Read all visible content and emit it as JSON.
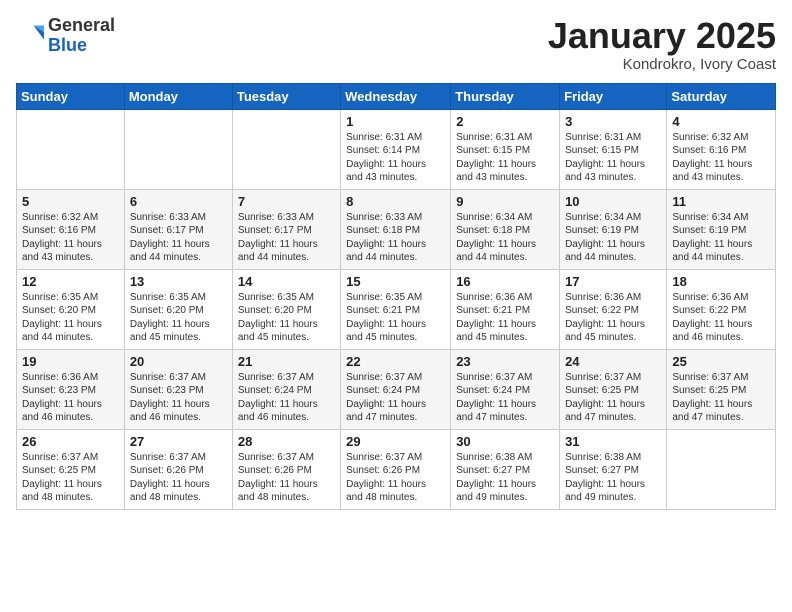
{
  "header": {
    "logo_general": "General",
    "logo_blue": "Blue",
    "month_title": "January 2025",
    "subtitle": "Kondrokro, Ivory Coast"
  },
  "weekdays": [
    "Sunday",
    "Monday",
    "Tuesday",
    "Wednesday",
    "Thursday",
    "Friday",
    "Saturday"
  ],
  "weeks": [
    [
      {
        "day": "",
        "info": ""
      },
      {
        "day": "",
        "info": ""
      },
      {
        "day": "",
        "info": ""
      },
      {
        "day": "1",
        "info": "Sunrise: 6:31 AM\nSunset: 6:14 PM\nDaylight: 11 hours\nand 43 minutes."
      },
      {
        "day": "2",
        "info": "Sunrise: 6:31 AM\nSunset: 6:15 PM\nDaylight: 11 hours\nand 43 minutes."
      },
      {
        "day": "3",
        "info": "Sunrise: 6:31 AM\nSunset: 6:15 PM\nDaylight: 11 hours\nand 43 minutes."
      },
      {
        "day": "4",
        "info": "Sunrise: 6:32 AM\nSunset: 6:16 PM\nDaylight: 11 hours\nand 43 minutes."
      }
    ],
    [
      {
        "day": "5",
        "info": "Sunrise: 6:32 AM\nSunset: 6:16 PM\nDaylight: 11 hours\nand 43 minutes."
      },
      {
        "day": "6",
        "info": "Sunrise: 6:33 AM\nSunset: 6:17 PM\nDaylight: 11 hours\nand 44 minutes."
      },
      {
        "day": "7",
        "info": "Sunrise: 6:33 AM\nSunset: 6:17 PM\nDaylight: 11 hours\nand 44 minutes."
      },
      {
        "day": "8",
        "info": "Sunrise: 6:33 AM\nSunset: 6:18 PM\nDaylight: 11 hours\nand 44 minutes."
      },
      {
        "day": "9",
        "info": "Sunrise: 6:34 AM\nSunset: 6:18 PM\nDaylight: 11 hours\nand 44 minutes."
      },
      {
        "day": "10",
        "info": "Sunrise: 6:34 AM\nSunset: 6:19 PM\nDaylight: 11 hours\nand 44 minutes."
      },
      {
        "day": "11",
        "info": "Sunrise: 6:34 AM\nSunset: 6:19 PM\nDaylight: 11 hours\nand 44 minutes."
      }
    ],
    [
      {
        "day": "12",
        "info": "Sunrise: 6:35 AM\nSunset: 6:20 PM\nDaylight: 11 hours\nand 44 minutes."
      },
      {
        "day": "13",
        "info": "Sunrise: 6:35 AM\nSunset: 6:20 PM\nDaylight: 11 hours\nand 45 minutes."
      },
      {
        "day": "14",
        "info": "Sunrise: 6:35 AM\nSunset: 6:20 PM\nDaylight: 11 hours\nand 45 minutes."
      },
      {
        "day": "15",
        "info": "Sunrise: 6:35 AM\nSunset: 6:21 PM\nDaylight: 11 hours\nand 45 minutes."
      },
      {
        "day": "16",
        "info": "Sunrise: 6:36 AM\nSunset: 6:21 PM\nDaylight: 11 hours\nand 45 minutes."
      },
      {
        "day": "17",
        "info": "Sunrise: 6:36 AM\nSunset: 6:22 PM\nDaylight: 11 hours\nand 45 minutes."
      },
      {
        "day": "18",
        "info": "Sunrise: 6:36 AM\nSunset: 6:22 PM\nDaylight: 11 hours\nand 46 minutes."
      }
    ],
    [
      {
        "day": "19",
        "info": "Sunrise: 6:36 AM\nSunset: 6:23 PM\nDaylight: 11 hours\nand 46 minutes."
      },
      {
        "day": "20",
        "info": "Sunrise: 6:37 AM\nSunset: 6:23 PM\nDaylight: 11 hours\nand 46 minutes."
      },
      {
        "day": "21",
        "info": "Sunrise: 6:37 AM\nSunset: 6:24 PM\nDaylight: 11 hours\nand 46 minutes."
      },
      {
        "day": "22",
        "info": "Sunrise: 6:37 AM\nSunset: 6:24 PM\nDaylight: 11 hours\nand 47 minutes."
      },
      {
        "day": "23",
        "info": "Sunrise: 6:37 AM\nSunset: 6:24 PM\nDaylight: 11 hours\nand 47 minutes."
      },
      {
        "day": "24",
        "info": "Sunrise: 6:37 AM\nSunset: 6:25 PM\nDaylight: 11 hours\nand 47 minutes."
      },
      {
        "day": "25",
        "info": "Sunrise: 6:37 AM\nSunset: 6:25 PM\nDaylight: 11 hours\nand 47 minutes."
      }
    ],
    [
      {
        "day": "26",
        "info": "Sunrise: 6:37 AM\nSunset: 6:25 PM\nDaylight: 11 hours\nand 48 minutes."
      },
      {
        "day": "27",
        "info": "Sunrise: 6:37 AM\nSunset: 6:26 PM\nDaylight: 11 hours\nand 48 minutes."
      },
      {
        "day": "28",
        "info": "Sunrise: 6:37 AM\nSunset: 6:26 PM\nDaylight: 11 hours\nand 48 minutes."
      },
      {
        "day": "29",
        "info": "Sunrise: 6:37 AM\nSunset: 6:26 PM\nDaylight: 11 hours\nand 48 minutes."
      },
      {
        "day": "30",
        "info": "Sunrise: 6:38 AM\nSunset: 6:27 PM\nDaylight: 11 hours\nand 49 minutes."
      },
      {
        "day": "31",
        "info": "Sunrise: 6:38 AM\nSunset: 6:27 PM\nDaylight: 11 hours\nand 49 minutes."
      },
      {
        "day": "",
        "info": ""
      }
    ]
  ]
}
